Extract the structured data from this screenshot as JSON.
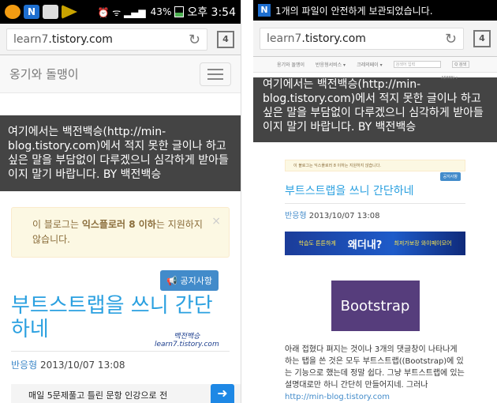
{
  "phone1": {
    "status": {
      "battery_pct": "43%",
      "time": "오후 3:54"
    },
    "url": {
      "host": "learn7",
      "domain": ".tistory.com",
      "tab_count": "4"
    },
    "navbar": {
      "brand": "옹기와 돌맹이"
    },
    "banner_text": "여기에서는 백전백승(http://min-blog.tistory.com)에서 적지 못한 글이나 하고 싶은 말을 부담없이 다루겠으니 심각하게 받아들이지 말기 바랍니다. BY 백전백승",
    "alert": {
      "prefix": "이 블로그는 ",
      "bold": "익스플로러 8 이하",
      "suffix": "는 지원하지 않습니다.",
      "close": "×"
    },
    "notice_button": "공지사항",
    "post": {
      "title": "부트스트랩을 쓰니 간단하네",
      "signature_line1": "백전백승",
      "signature_line2": "learn7.tistory.com",
      "author": "반응형",
      "date": "2013/10/07 13:08"
    },
    "bottom_ad": {
      "text": "매일 5문제풀고 틀린 문항 인강으로 전",
      "arrow": "➜"
    }
  },
  "phone2": {
    "toast": {
      "icon": "N",
      "text": "1개의 파일이 안전하게 보관되었습니다."
    },
    "url": {
      "host": "learn7",
      "domain": ".tistory.com",
      "tab_count": "4"
    },
    "mini_nav": {
      "brand": "옹기와 돌맹이",
      "menu1": "반응형서비스 ▾",
      "menu2": "크레의페이 ▾",
      "search_placeholder": "검색어 입력",
      "search_button": "Q 검색",
      "admin": "ADMIN ▾"
    },
    "banner_text_partial": "여기에서는 백전백승(http://min-blog.tistory.com)에서 적지 못한 글이나 하고 싶은 말을 부담없이 다루겠으니 심각하게 받아들이지 말기 바랍니다. BY 백전백승",
    "alert": "이 블로그는 익스플로러 8 이하는 지원하지 않습니다.",
    "notice_button": "공지사항",
    "post": {
      "title": "부트스트랩을 쓰니 간단하네",
      "author": "반응형",
      "date": "2013/10/07 13:08"
    },
    "ad": {
      "left_small": "학습도 튼튼하게",
      "main": "왜더내?",
      "right_small": "최저가보장 와이페이모어"
    },
    "bootstrap_label": "Bootstrap",
    "body": "아래 접혔다 펴지는 것이나 3개의 댓글창이 나타나게 하는 탭을 쓴 것은 모두 부트스트랩((Bootstrap)에 있는 기능으로 했는데 정말 쉽다. 그냥 부트스트랩에 있는 설명대로만 하니 간단히 만들어지네. 그러나 ",
    "body_link": "http://min-blog.tistory.com"
  }
}
